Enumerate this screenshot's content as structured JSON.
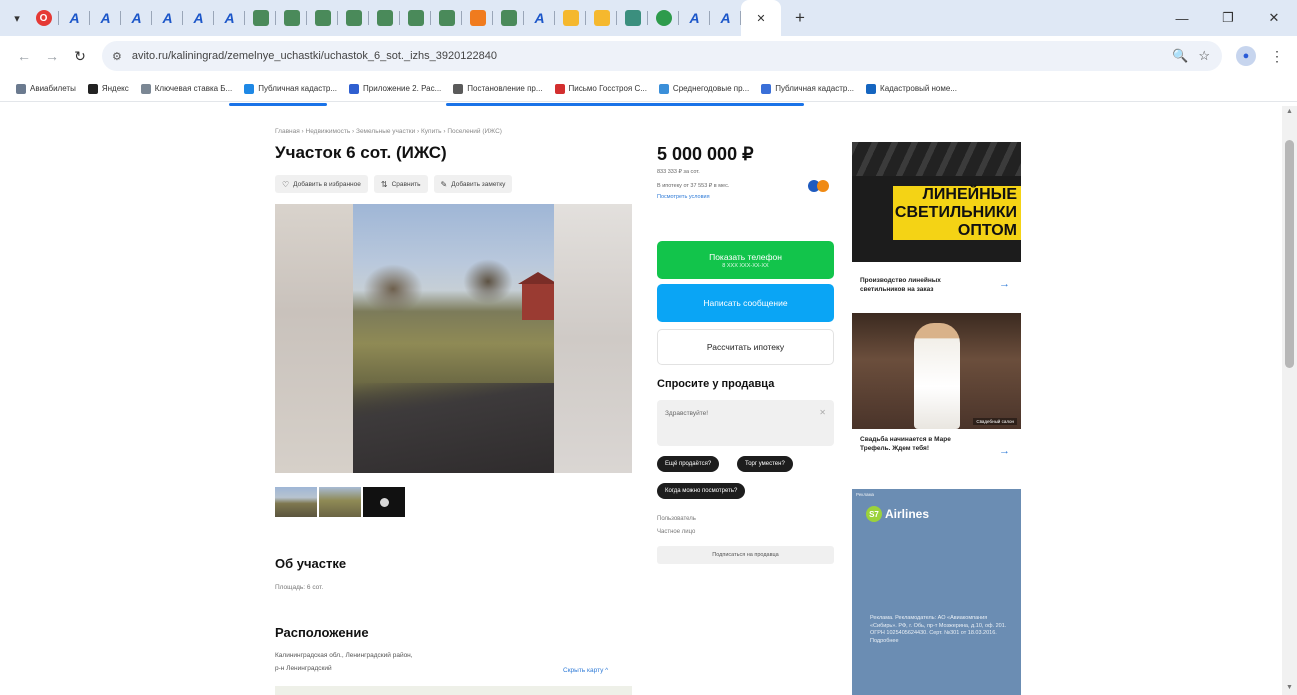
{
  "browser": {
    "tabs": [
      {
        "icon": "opera-icon",
        "label": "O",
        "style": "red"
      },
      {
        "icon": "avito-icon",
        "label": "A",
        "style": "blue"
      },
      {
        "icon": "avito-icon",
        "label": "A",
        "style": "blue"
      },
      {
        "icon": "avito-icon",
        "label": "A",
        "style": "blue"
      },
      {
        "icon": "avito-icon",
        "label": "A",
        "style": "blue"
      },
      {
        "icon": "avito-icon",
        "label": "A",
        "style": "blue"
      },
      {
        "icon": "avito-icon",
        "label": "A",
        "style": "blue"
      },
      {
        "icon": "site-icon",
        "label": "",
        "style": "green"
      },
      {
        "icon": "site-icon",
        "label": "",
        "style": "green"
      },
      {
        "icon": "site-icon",
        "label": "",
        "style": "green"
      },
      {
        "icon": "site-icon",
        "label": "",
        "style": "green"
      },
      {
        "icon": "site-icon",
        "label": "",
        "style": "green"
      },
      {
        "icon": "site-icon",
        "label": "",
        "style": "green"
      },
      {
        "icon": "site-icon",
        "label": "",
        "style": "green"
      },
      {
        "icon": "doc-icon",
        "label": "",
        "style": "orange"
      },
      {
        "icon": "site-icon",
        "label": "",
        "style": "green"
      },
      {
        "icon": "avito-icon",
        "label": "A",
        "style": "blue"
      },
      {
        "icon": "flag-icon",
        "label": "",
        "style": "yellow"
      },
      {
        "icon": "flag-icon",
        "label": "",
        "style": "yellow"
      },
      {
        "icon": "gallery-icon",
        "label": "",
        "style": "teal"
      },
      {
        "icon": "check-icon",
        "label": "",
        "style": "circle-green"
      },
      {
        "icon": "avito-icon",
        "label": "A",
        "style": "blue"
      },
      {
        "icon": "avito-icon",
        "label": "A",
        "style": "blue"
      }
    ],
    "active_tab_close": "✕",
    "new_tab": "+",
    "url": "avito.ru/kaliningrad/zemelnye_uchastki/uchastok_6_sot._izhs_3920122840",
    "bookmarks": [
      {
        "label": "Авиабилеты",
        "icon": "plane-icon",
        "color": "#6b7a8f"
      },
      {
        "label": "Яндекс",
        "icon": "yandex-icon",
        "color": "#222222"
      },
      {
        "label": "Ключевая ставка Б...",
        "icon": "bank-icon",
        "color": "#7b8794"
      },
      {
        "label": "Публичная кадастр...",
        "icon": "map-icon",
        "color": "#1e88e5"
      },
      {
        "label": "Приложение 2. Рас...",
        "icon": "doc-icon",
        "color": "#2f5fd0"
      },
      {
        "label": "Постановление пр...",
        "icon": "law-icon",
        "color": "#5a5a5a"
      },
      {
        "label": "Письмо Госстроя С...",
        "icon": "star-icon",
        "color": "#d32f2f"
      },
      {
        "label": "Среднегодовые пр...",
        "icon": "globe-icon",
        "color": "#3b8fd9"
      },
      {
        "label": "Публичная кадастр...",
        "icon": "folder-icon",
        "color": "#3a6fd8"
      },
      {
        "label": "Кадастровый номе...",
        "icon": "check-icon",
        "color": "#1565c0"
      }
    ]
  },
  "listing": {
    "breadcrumb": "Главная › Недвижимость › Земельные участки › Купить › Поселений (ИЖС)",
    "title": "Участок 6 сот. (ИЖС)",
    "actions": [
      {
        "icon": "heart-icon",
        "label": "Добавить в избранное"
      },
      {
        "icon": "compare-icon",
        "label": "Сравнить"
      },
      {
        "icon": "note-icon",
        "label": "Добавить заметку"
      }
    ],
    "about_title": "Об участке",
    "area": "Площадь: 6 сот.",
    "location_title": "Расположение",
    "address_line1": "Калининградская обл., Ленинградский район,",
    "address_line2": "р-н Ленинградский",
    "show_map": "Скрыть карту ^"
  },
  "price": {
    "value": "5 000 000 ₽",
    "per_unit": "833 333 ₽ за сот.",
    "mortgage": "В ипотеку от 37 553 ₽ в мес.",
    "mortgage_link": "Посмотреть условия"
  },
  "contact": {
    "show_phone": "Показать телефон",
    "show_phone_sub": "8 ХХХ ХХХ-ХХ-ХХ",
    "write_message": "Написать сообщение",
    "mortgage_calc": "Рассчитать ипотеку",
    "ask_title": "Спросите у продавца",
    "ask_placeholder": "Здравствуйте!",
    "chips": [
      "Ещё продаётся?",
      "Торг уместен?",
      "Когда можно посмотреть?"
    ],
    "seller_type": "Пользователь",
    "seller_kind": "Частное лицо",
    "subscribe": "Подписаться на продавца"
  },
  "ads": {
    "ad1_lines": [
      "ЛИНЕЙНЫЕ",
      "СВЕТИЛЬНИКИ",
      "ОПТОМ"
    ],
    "ad1_caption": "Производство линейных светильников на заказ",
    "ad2_caption": "Свадьба начинается в Маре Трефель. Ждем тебя!",
    "ad2_badge": "Свадебный салон",
    "ad3_brand": "Airlines",
    "ad3_brand_mark": "S7",
    "ad3_legal": "Реклама. Рекламодатель: АО «Авиакомпания «Сибирь». РФ, г. Обь, пр-т Мозжерина, д.10, оф. 201. ОГРН 1025405624430. Серт. №301 от 18.03.2016. Подробнее",
    "ad_label": "Реклама"
  },
  "colors": {
    "green_button": "#12c44b",
    "blue_button": "#0aa5f5",
    "link": "#2f7bd7",
    "ad_yellow": "#f4d315",
    "airline_bg": "#6b8db3"
  }
}
